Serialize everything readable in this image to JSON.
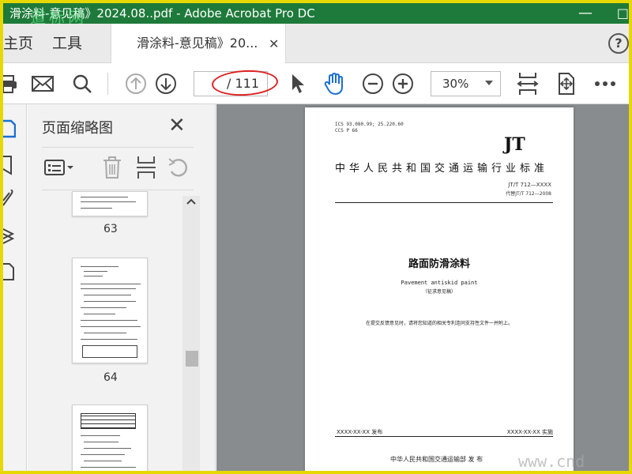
{
  "window": {
    "title": "滑涂料-意见稿》2024.08..pdf - Adobe Acrobat Pro DC",
    "minimize_glyph": "—",
    "maximize_glyph": "□"
  },
  "watermark_top": "道标网",
  "watermark_bottom": "www.cnd",
  "tabs": {
    "home": "主页",
    "tools": "工具",
    "document": "滑涂料-意见稿》20...",
    "close_glyph": "✕"
  },
  "help": {
    "label": "?"
  },
  "toolbar": {
    "page_total": "/ 111",
    "zoom": "30%",
    "icons": [
      "print-icon",
      "email-icon",
      "search-icon",
      "page-up-icon",
      "page-down-icon",
      "select-cursor-icon",
      "hand-tool-icon",
      "zoom-out-icon",
      "zoom-in-icon",
      "fit-page-icon",
      "full-screen-icon",
      "more-icon"
    ],
    "accent_color": "#1a6fd1"
  },
  "leftrail": {
    "icons": [
      "page-thumbnails-icon",
      "bookmark-icon",
      "attachment-icon",
      "layers-icon",
      "page-copy-icon"
    ]
  },
  "thumbnail_panel": {
    "title": "页面缩略图",
    "close_glyph": "✕",
    "tools": [
      "page-options-icon",
      "delete-page-icon",
      "insert-page-icon",
      "rotate-page-icon"
    ],
    "thumbnails": [
      {
        "label": "63"
      },
      {
        "label": "64"
      },
      {
        "label": ""
      }
    ]
  },
  "document": {
    "ics_line": "ICS  93.080.99; 25.220.60",
    "ccs_line": "CCS  P 66",
    "jt": "JT",
    "standard_name": "中华人民共和国交通运输行业标准",
    "standard_number": "JT/T 712—XXXX",
    "replaces": "代替JT/T 712—2008",
    "title_cn": "路面防滑涂料",
    "title_en": "Pavement antiskid paint",
    "draft_note": "（征求意见稿）",
    "notice": "在提交反馈意见时，请将您知道的相关专利连同支持性文件一并附上。",
    "publish_date": "XXXX-XX-XX 发布",
    "implement_date": "XXXX-XX-XX 实施",
    "issuer": "中华人民共和国交通运输部    发  布"
  }
}
